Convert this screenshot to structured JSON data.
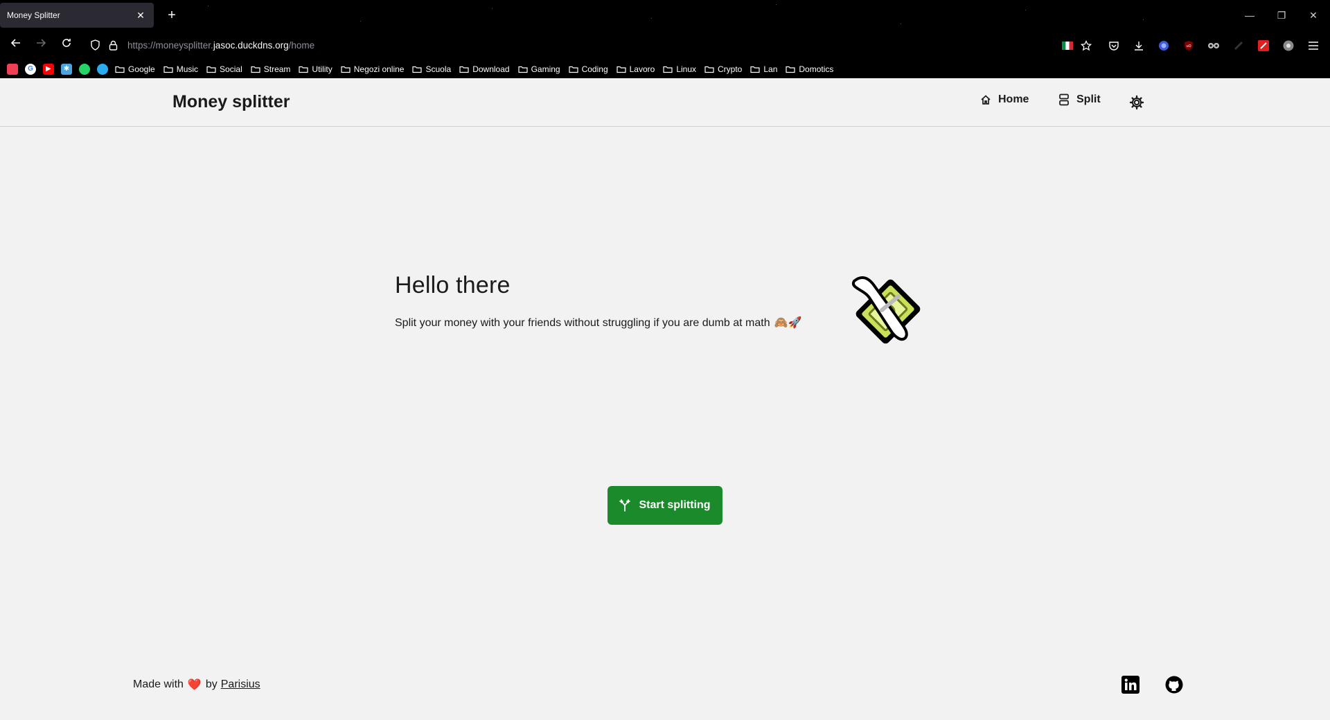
{
  "browser": {
    "tab_title": "Money Splitter",
    "tab_close": "✕",
    "new_tab": "+",
    "url_prefix": "https://moneysplitter.",
    "url_host": "jasoc.duckdns.org",
    "url_path": "/home",
    "window_controls": [
      "—",
      "❐",
      "✕"
    ],
    "bookmark_favicons": [
      "pocket-icon",
      "google-icon",
      "youtube-icon",
      "jellyfin-icon",
      "whatsapp-icon",
      "telegram-icon"
    ],
    "bookmark_folders": [
      "Google",
      "Music",
      "Social",
      "Stream",
      "Utility",
      "Negozi online",
      "Scuola",
      "Download",
      "Gaming",
      "Coding",
      "Lavoro",
      "Linux",
      "Crypto",
      "Lan",
      "Domotics"
    ]
  },
  "site": {
    "brand": "Money splitter",
    "nav": {
      "home": "Home",
      "split": "Split"
    },
    "hero": {
      "title": "Hello there",
      "subtitle": "Split your money with your friends without struggling if you are dumb at math",
      "subtitle_emoji": "🙈🚀"
    },
    "cta_label": "Start splitting",
    "footer": {
      "made_with": "Made with",
      "heart": "❤️",
      "by": "by",
      "author": "Parisius"
    }
  },
  "colors": {
    "accent_green": "#1a8a2a",
    "page_bg": "#f2f2f2",
    "chrome_bg": "#000000"
  }
}
